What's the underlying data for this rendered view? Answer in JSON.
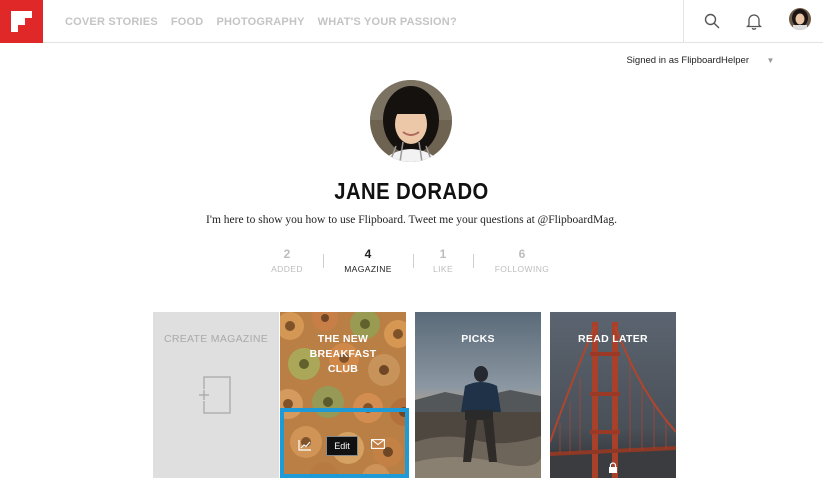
{
  "header": {
    "nav": [
      "COVER STORIES",
      "FOOD",
      "PHOTOGRAPHY",
      "WHAT'S YOUR PASSION?"
    ]
  },
  "account": {
    "signed_in": "Signed in as FlipboardHelper",
    "caret": "▼"
  },
  "profile": {
    "name": "JANE DORADO",
    "bio": "I'm here to show you how to use Flipboard. Tweet me your questions at @FlipboardMag."
  },
  "stats": [
    {
      "count": "2",
      "label": "ADDED"
    },
    {
      "count": "4",
      "label": "MAGAZINE",
      "active": true
    },
    {
      "count": "1",
      "label": "LIKE"
    },
    {
      "count": "6",
      "label": "FOLLOWING"
    }
  ],
  "tiles": [
    {
      "title": "CREATE MAGAZINE"
    },
    {
      "title": "THE NEW BREAKFAST CLUB"
    },
    {
      "title": "PICKS"
    },
    {
      "title": "READ LATER"
    }
  ],
  "tile_actions": {
    "edit": "Edit"
  },
  "colors": {
    "brand": "#e12828",
    "highlight": "#1e9ad6"
  }
}
